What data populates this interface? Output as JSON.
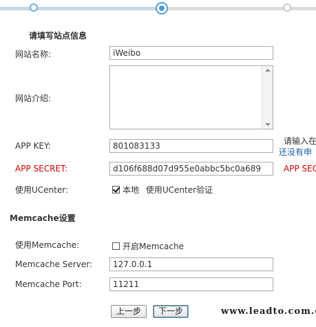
{
  "stepper": {
    "total_steps": 3,
    "current_step": 2
  },
  "site_info": {
    "title": "请填写站点信息",
    "site_name_label": "网站名称:",
    "site_name_value": "iWeibo",
    "site_intro_label": "网站介绍:",
    "site_intro_value": "",
    "app_key_label": "APP KEY:",
    "app_key_value": "801083133",
    "app_key_hint_line1": "请输入在",
    "app_key_hint_line2": "还没有申",
    "app_secret_label": "APP SECRET:",
    "app_secret_value": "d106f688d07d955e0abbc5bc0a689",
    "app_secret_hint": "APP SEC",
    "ucenter_label": "使用UCenter:",
    "ucenter_checkbox_label": "本地",
    "ucenter_checked": true,
    "ucenter_note": "使用UCenter验证"
  },
  "memcache": {
    "title": "Memcache设置",
    "use_label": "使用Memcache:",
    "enable_checkbox_label": "开启Memcache",
    "enable_checked": false,
    "server_label": "Memcache Server:",
    "server_value": "127.0.0.1",
    "port_label": "Memcache Port:",
    "port_value": "11211"
  },
  "buttons": {
    "prev_label": "上一步",
    "next_label": "下一步"
  },
  "watermark": "www.leadto.com.cn",
  "colors": {
    "accent": "#4b9fd5",
    "error_red": "#cc0000",
    "link_blue": "#1a5fa8"
  }
}
